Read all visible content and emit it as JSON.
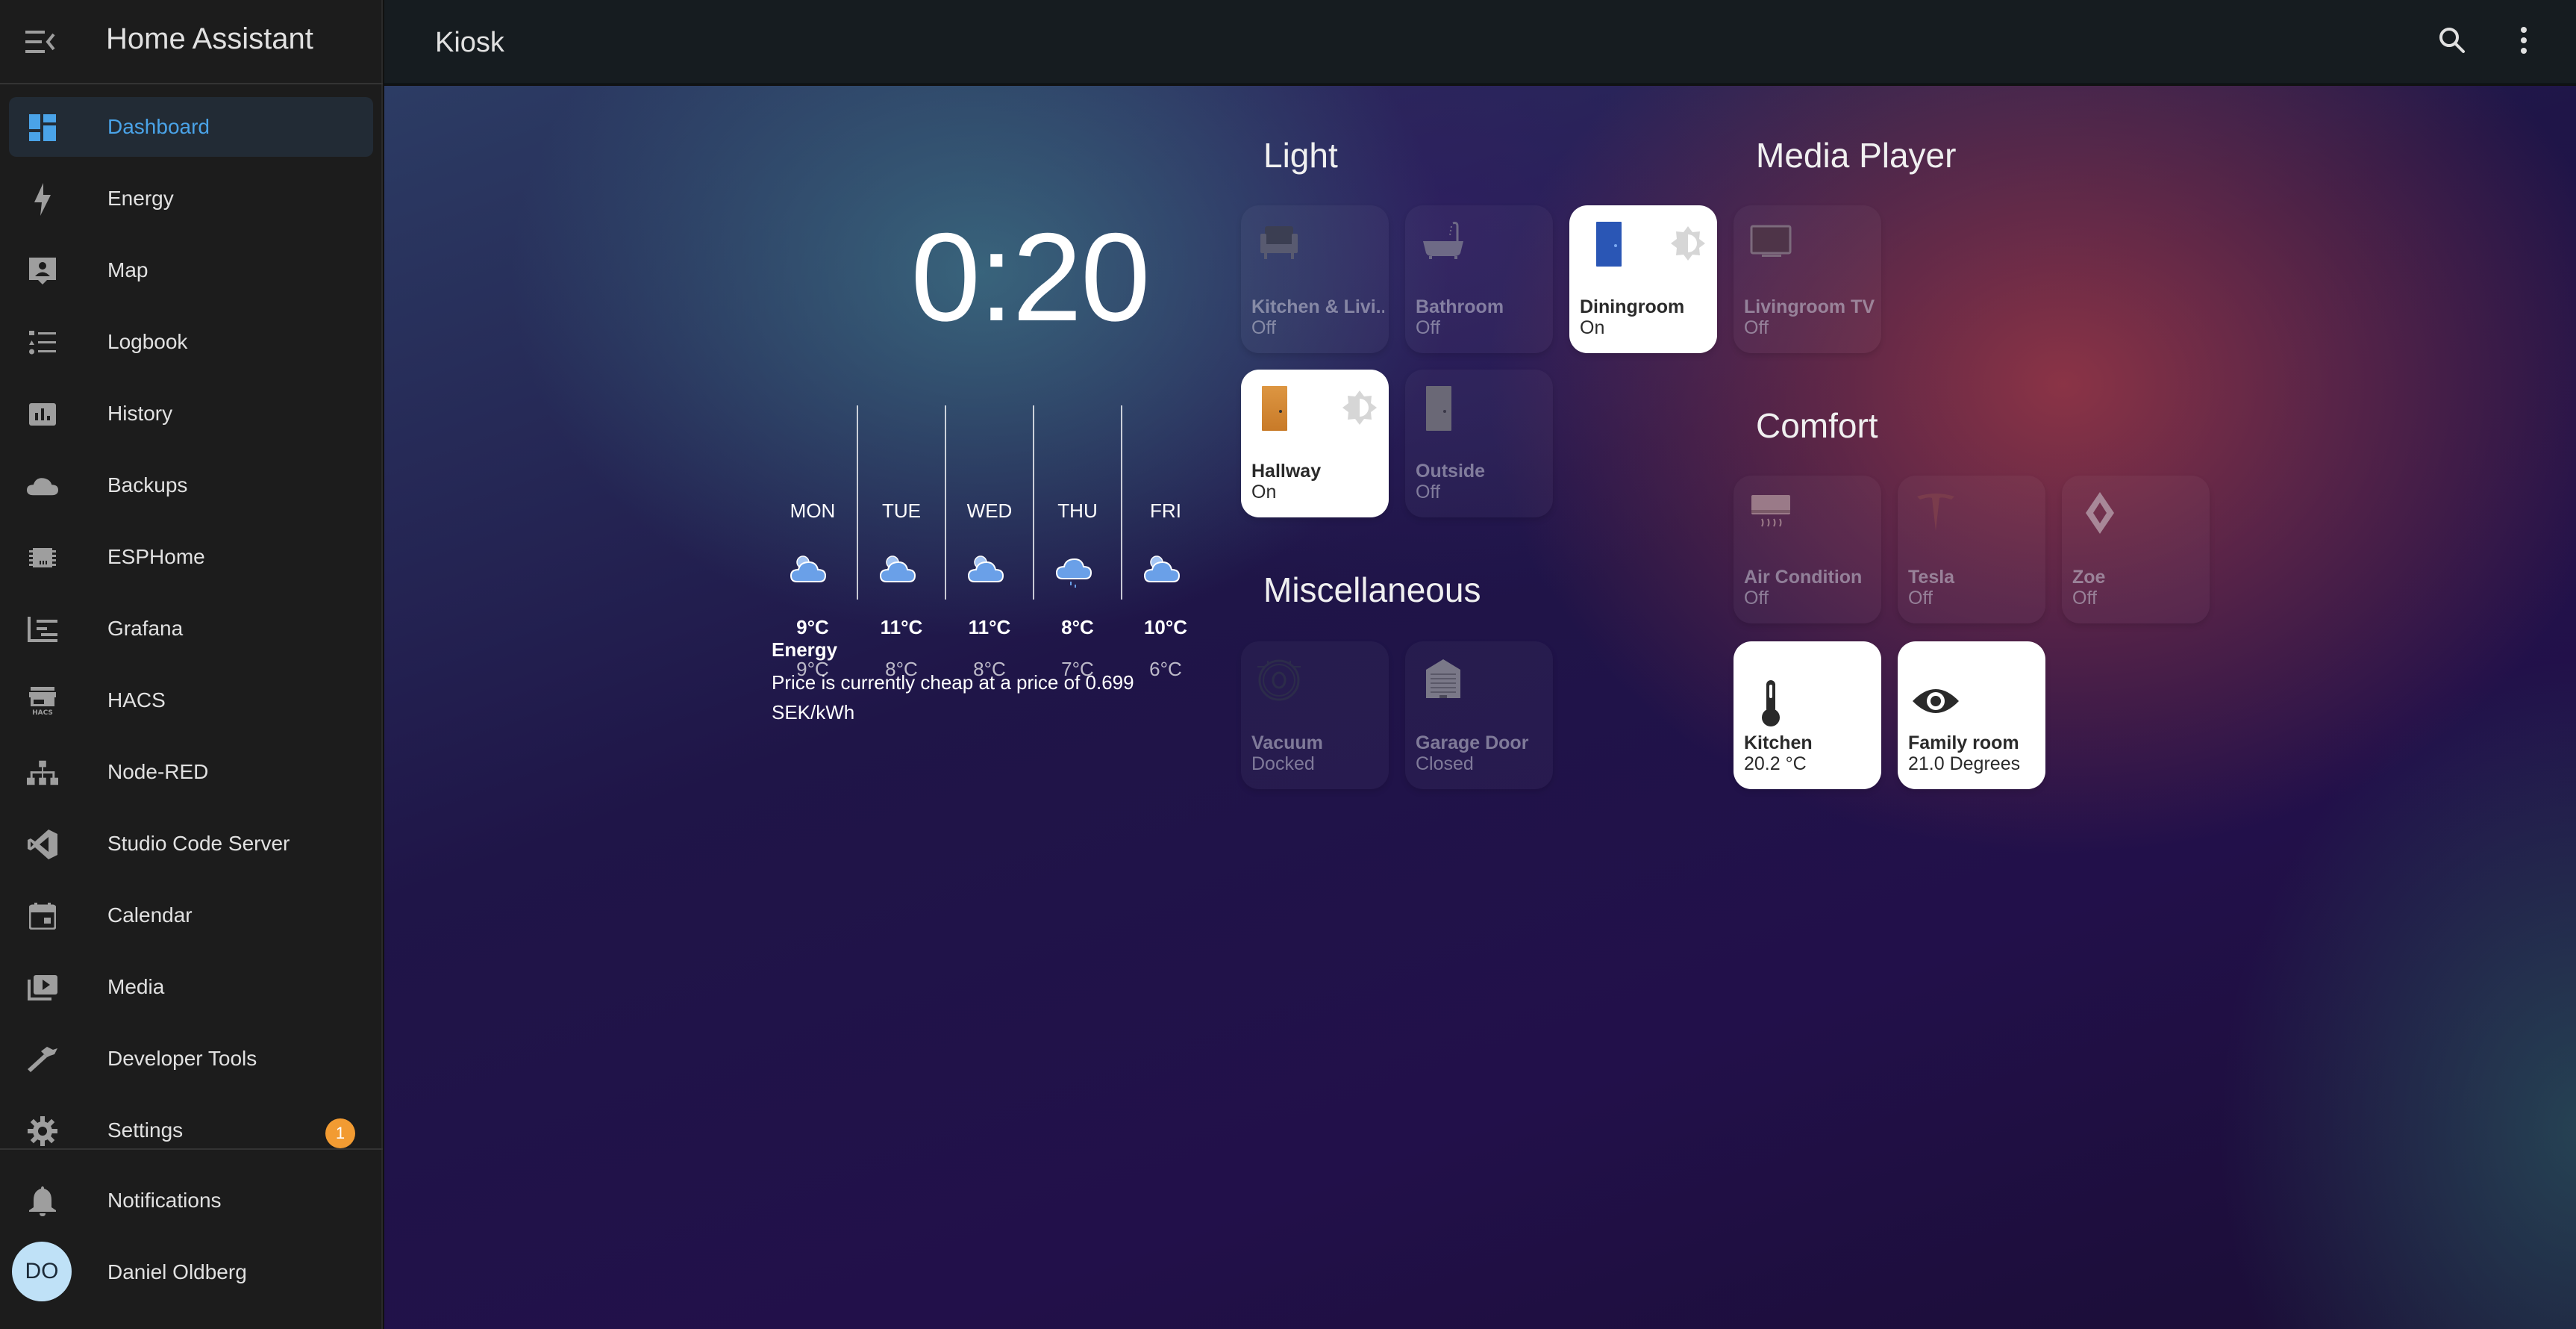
{
  "sidebar": {
    "title": "Home Assistant",
    "items": [
      {
        "label": "Dashboard",
        "icon": "dashboard-icon",
        "active": true
      },
      {
        "label": "Energy",
        "icon": "lightning-bolt-icon"
      },
      {
        "label": "Map",
        "icon": "map-account-icon"
      },
      {
        "label": "Logbook",
        "icon": "format-list-icon"
      },
      {
        "label": "History",
        "icon": "chart-box-icon"
      },
      {
        "label": "Backups",
        "icon": "cloud-icon"
      },
      {
        "label": "ESPHome",
        "icon": "chip-icon"
      },
      {
        "label": "Grafana",
        "icon": "grafana-chart-icon"
      },
      {
        "label": "HACS",
        "icon": "hacs-store-icon"
      },
      {
        "label": "Node-RED",
        "icon": "sitemap-icon"
      },
      {
        "label": "Studio Code Server",
        "icon": "vscode-icon"
      },
      {
        "label": "Calendar",
        "icon": "calendar-icon"
      },
      {
        "label": "Media",
        "icon": "play-box-multiple-icon"
      },
      {
        "label": "Developer Tools",
        "icon": "hammer-icon"
      },
      {
        "label": "Settings",
        "icon": "cog-icon",
        "badge": "1"
      }
    ],
    "notifications_label": "Notifications",
    "user": {
      "name": "Daniel Oldberg",
      "initials": "DO"
    }
  },
  "header": {
    "title": "Kiosk",
    "search_icon": "search-icon",
    "menu_icon": "dots-vertical-icon"
  },
  "clock": {
    "time": "0:20"
  },
  "weather": {
    "days": [
      {
        "day": "MON",
        "condition": "partlycloudy",
        "high": "9°C",
        "low": "9°C"
      },
      {
        "day": "TUE",
        "condition": "partlycloudy",
        "high": "11°C",
        "low": "8°C"
      },
      {
        "day": "WED",
        "condition": "partlycloudy",
        "high": "11°C",
        "low": "8°C"
      },
      {
        "day": "THU",
        "condition": "rainy",
        "high": "8°C",
        "low": "7°C"
      },
      {
        "day": "FRI",
        "condition": "partlycloudy",
        "high": "10°C",
        "low": "6°C"
      }
    ]
  },
  "energy": {
    "title": "Energy",
    "text": "Price is currently cheap at a price of 0.699 SEK/kWh"
  },
  "sections": {
    "light": {
      "title": "Light",
      "tiles": [
        {
          "name": "Kitchen & Livi...",
          "state": "Off",
          "icon": "armchair-icon"
        },
        {
          "name": "Bathroom",
          "state": "Off",
          "icon": "bathtub-icon"
        },
        {
          "name": "Diningroom",
          "state": "On",
          "icon": "door-blue-icon",
          "on": true
        },
        {
          "name": "Hallway",
          "state": "On",
          "icon": "door-orange-icon",
          "on": true
        },
        {
          "name": "Outside",
          "state": "Off",
          "icon": "door-grey-icon"
        }
      ]
    },
    "media_player": {
      "title": "Media Player",
      "tiles": [
        {
          "name": "Livingroom TV",
          "state": "Off",
          "icon": "television-icon"
        }
      ]
    },
    "comfort": {
      "title": "Comfort",
      "tiles": [
        {
          "name": "Air Condition",
          "state": "Off",
          "icon": "air-conditioner-icon"
        },
        {
          "name": "Tesla",
          "state": "Off",
          "icon": "tesla-logo-icon"
        },
        {
          "name": "Zoe",
          "state": "Off",
          "icon": "renault-logo-icon"
        },
        {
          "name": "Kitchen",
          "state": "20.2 °C",
          "icon": "thermometer-icon",
          "on": true
        },
        {
          "name": "Family room",
          "state": "21.0 Degrees",
          "icon": "eye-icon",
          "on": true
        }
      ]
    },
    "miscellaneous": {
      "title": "Miscellaneous",
      "tiles": [
        {
          "name": "Vacuum",
          "state": "Docked",
          "icon": "robot-vacuum-icon"
        },
        {
          "name": "Garage Door",
          "state": "Closed",
          "icon": "garage-icon"
        }
      ]
    }
  },
  "colors": {
    "accent": "#4aa3e8",
    "badge": "#f29b32",
    "avatar_bg": "#bfe1f7",
    "sidebar_bg": "#1c1c1c",
    "header_bg": "#161c20",
    "weather_icon": "#6aa0e8"
  }
}
